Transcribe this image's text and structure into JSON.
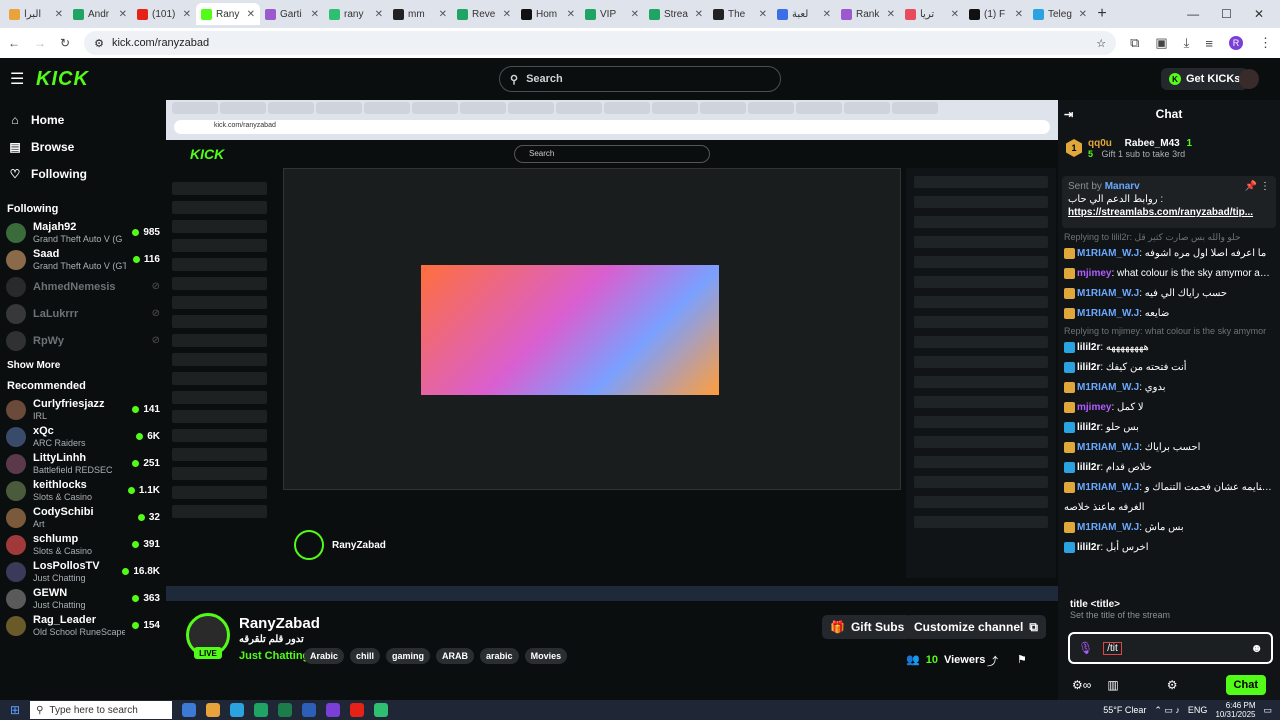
{
  "browser": {
    "tabs": [
      {
        "title": "البرا",
        "color": "#e8a33b"
      },
      {
        "title": "Andr",
        "color": "#1fa463"
      },
      {
        "title": "(101)",
        "color": "#e62117"
      },
      {
        "title": "Rany",
        "color": "#53fc18",
        "active": true
      },
      {
        "title": "Garti",
        "color": "#9b59d0"
      },
      {
        "title": "rany",
        "color": "#2fbf71"
      },
      {
        "title": "mm",
        "color": "#222222"
      },
      {
        "title": "Reve",
        "color": "#1fa463"
      },
      {
        "title": "Hom",
        "color": "#111111"
      },
      {
        "title": "VIP",
        "color": "#1fa463"
      },
      {
        "title": "Strea",
        "color": "#1fa463"
      },
      {
        "title": "The",
        "color": "#222222"
      },
      {
        "title": "لعبة",
        "color": "#3b6fe8"
      },
      {
        "title": "Rank",
        "color": "#9b59d0"
      },
      {
        "title": "تريا",
        "color": "#e84c5a"
      },
      {
        "title": "(1) F",
        "color": "#111111"
      },
      {
        "title": "Teleg",
        "color": "#2aa3e0"
      }
    ],
    "url": "kick.com/ranyzabad",
    "profile_initial": "R"
  },
  "topbar": {
    "logo": "KICK",
    "search_placeholder": "Search",
    "get_kicks": "Get KICKs"
  },
  "sidebar": {
    "nav": [
      {
        "label": "Home",
        "icon": "home-icon",
        "glyph": "⌂"
      },
      {
        "label": "Browse",
        "icon": "browse-icon",
        "glyph": "▤"
      },
      {
        "label": "Following",
        "icon": "heart-icon",
        "glyph": "♡"
      }
    ],
    "following_heading": "Following",
    "following": [
      {
        "name": "Majah92",
        "category": "Grand Theft Auto V (G",
        "viewers": "985",
        "live": true,
        "color": "#3a6b3a"
      },
      {
        "name": "Saad",
        "category": "Grand Theft Auto V (GT",
        "viewers": "116",
        "live": true,
        "color": "#8a6a4a"
      },
      {
        "name": "AhmedNemesis",
        "category": "",
        "viewers": "",
        "live": false,
        "color": "#555555"
      },
      {
        "name": "LaLukrrr",
        "category": "",
        "viewers": "",
        "live": false,
        "color": "#777777"
      },
      {
        "name": "RpWy",
        "category": "",
        "viewers": "",
        "live": false,
        "color": "#666666"
      }
    ],
    "show_more": "Show More",
    "recommended_heading": "Recommended",
    "recommended": [
      {
        "name": "Curlyfriesjazz",
        "category": "IRL",
        "viewers": "141",
        "color": "#6a4a3a"
      },
      {
        "name": "xQc",
        "category": "ARC Raiders",
        "viewers": "6K",
        "color": "#3a4a6a"
      },
      {
        "name": "LittyLinhh",
        "category": "Battlefield REDSEC",
        "viewers": "251",
        "color": "#5a3a4a"
      },
      {
        "name": "keithlocks",
        "category": "Slots & Casino",
        "viewers": "1.1K",
        "color": "#4a5a3a"
      },
      {
        "name": "CodySchibi",
        "category": "Art",
        "viewers": "32",
        "color": "#7a5a3a"
      },
      {
        "name": "schlump",
        "category": "Slots & Casino",
        "viewers": "391",
        "color": "#a03a3a"
      },
      {
        "name": "LosPollosTV",
        "category": "Just Chatting",
        "viewers": "16.8K",
        "color": "#3a3a5a"
      },
      {
        "name": "GEWN",
        "category": "Just Chatting",
        "viewers": "363",
        "color": "#5a5a5a"
      },
      {
        "name": "Rag_Leader",
        "category": "Old School RuneScape",
        "viewers": "154",
        "color": "#6a5a2a"
      }
    ]
  },
  "player": {
    "inner_url": "kick.com/ranyzabad",
    "inner_search": "Search",
    "inner_channel": "RanyZabad"
  },
  "channel": {
    "name": "RanyZabad",
    "live_badge": "LIVE",
    "title": "تدور قلم تلقرقه",
    "category": "Just Chatting",
    "tags": [
      "Arabic",
      "chill",
      "gaming",
      "ARAB",
      "arabic",
      "Movies"
    ],
    "gift_subs": "Gift Subs",
    "customize": "Customize channel",
    "viewers": "10",
    "viewers_label": "Viewers"
  },
  "chat": {
    "title": "Chat",
    "top_gifter": {
      "name": "qq0u",
      "count": "5",
      "rank": "1",
      "second": "Rabee_M43",
      "second_rank": "1",
      "second_note": "Gift 1 sub to take 3rd"
    },
    "pinned": {
      "sent_by": "Sent by",
      "user": "Manarv",
      "text": "روابط الدعم الي حاب :",
      "link": "https://streamlabs.com/ranyzabad/tip..."
    },
    "messages": [
      {
        "reply": "Replying to lilil2r: حلو والله بس صارت كثير قل"
      },
      {
        "user": "M1RIAM_W.J",
        "color": "#6aa8ff",
        "badge": "#e0a83b",
        "text": "ما اعرفه اصلا اول مره اشوفه"
      },
      {
        "user": "mjimey",
        "color": "#b05cff",
        "badge": "#e0a83b",
        "text": "what colour is the sky amymor amymor"
      },
      {
        "user": "M1RIAM_W.J",
        "color": "#6aa8ff",
        "badge": "#e0a83b",
        "text": "حسب راياك الي فيه"
      },
      {
        "user": "M1RIAM_W.J",
        "color": "#6aa8ff",
        "badge": "#e0a83b",
        "text": "ضايعه"
      },
      {
        "reply": "Replying to mjimey: what colour is the sky amymor"
      },
      {
        "user": "lilil2r",
        "color": "#ffffff",
        "badge": "#2aa3e0",
        "text": "ههههههههه"
      },
      {
        "user": "lilil2r",
        "color": "#ffffff",
        "badge": "#2aa3e0",
        "text": "أنت فتحته من كيفك"
      },
      {
        "user": "M1RIAM_W.J",
        "color": "#6aa8ff",
        "badge": "#e0a83b",
        "text": "بدوي"
      },
      {
        "user": "mjimey",
        "color": "#b05cff",
        "badge": "#e0a83b",
        "text": "لا كمل"
      },
      {
        "user": "lilil2r",
        "color": "#ffffff",
        "badge": "#2aa3e0",
        "text": "بس حلو"
      },
      {
        "user": "M1RIAM_W.J",
        "color": "#6aa8ff",
        "badge": "#e0a83b",
        "text": "احسب براياك"
      },
      {
        "user": "lilil2r",
        "color": "#ffffff",
        "badge": "#2aa3e0",
        "text": "خلاص قدام"
      },
      {
        "user": "M1RIAM_W.J",
        "color": "#6aa8ff",
        "badge": "#e0a83b",
        "text": "فلك يحاول تنايمه عشان فحمت التنماك و"
      },
      {
        "user": "",
        "color": "#ffffff",
        "badge": "",
        "text": "الغرفه ماعنذ خلاصه"
      },
      {
        "user": "M1RIAM_W.J",
        "color": "#6aa8ff",
        "badge": "#e0a83b",
        "text": "بس ماش"
      },
      {
        "user": "lilil2r",
        "color": "#ffffff",
        "badge": "#2aa3e0",
        "text": "اخرس أبل"
      }
    ],
    "command": "title <title>",
    "command_desc": "Set the title of the stream",
    "input_value": "/tit",
    "send": "Chat"
  },
  "taskbar": {
    "search_placeholder": "Type here to search",
    "weather": "55°F Clear",
    "lang": "ENG",
    "time": "6:46 PM",
    "date": "10/31/2025"
  }
}
